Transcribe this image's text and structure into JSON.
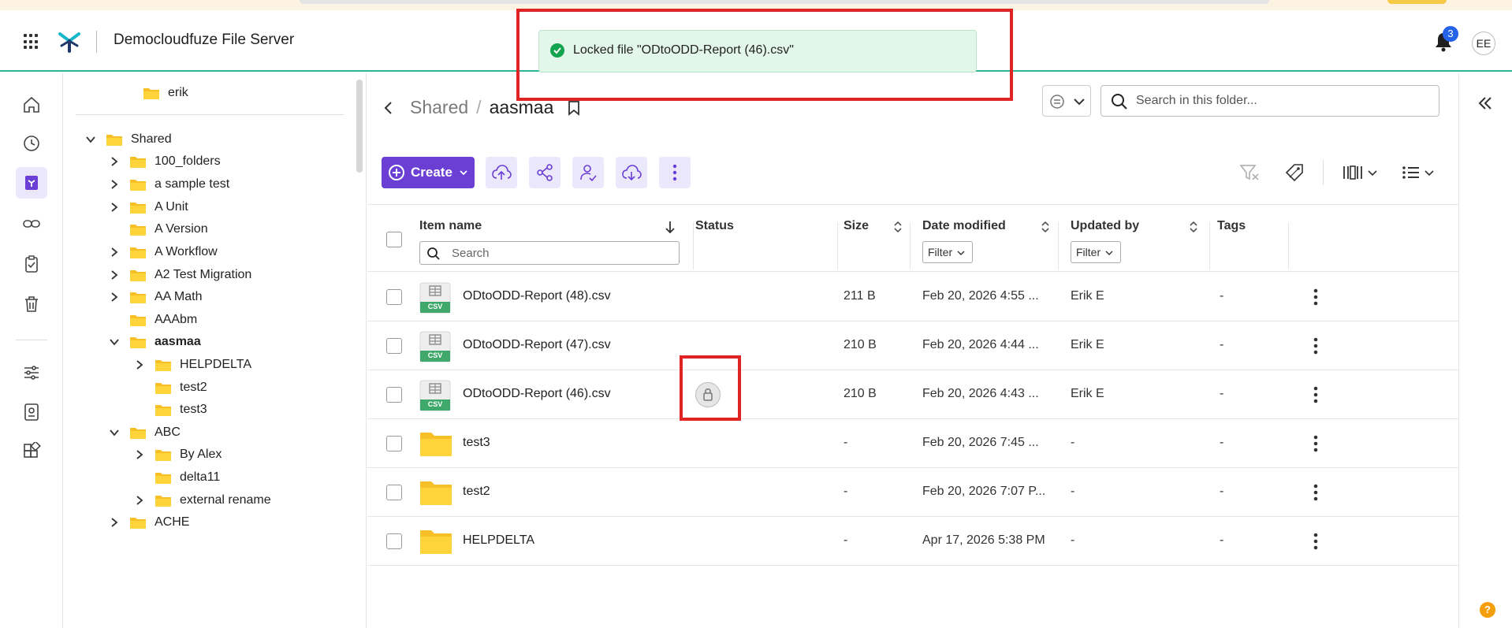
{
  "app": {
    "title": "Democloudfuze File Server",
    "notifications_count": "3",
    "user_initials": "EE",
    "accent_color": "#6b3fd4",
    "header_line_color": "#2fb39b"
  },
  "toast": {
    "message": "Locked file \"ODtoODD-Report (46).csv\"",
    "color": "#e3f6ea"
  },
  "rail": {
    "items": [
      "home-icon",
      "recent-clock-icon",
      "file-server-icon",
      "link-icon",
      "tasks-clipboard-icon",
      "trash-icon",
      "settings-sliders-icon",
      "report-icon",
      "apps-grid-icon"
    ]
  },
  "tree": {
    "items": [
      {
        "label": "erik",
        "chevron": "none",
        "bold": false
      },
      {
        "label": "Shared",
        "chevron": "down",
        "bold": false
      },
      {
        "label": "100_folders",
        "chevron": "right",
        "bold": false
      },
      {
        "label": "a sample test",
        "chevron": "right",
        "bold": false
      },
      {
        "label": "A Unit",
        "chevron": "right",
        "bold": false
      },
      {
        "label": "A Version",
        "chevron": "none",
        "bold": false
      },
      {
        "label": "A Workflow",
        "chevron": "right",
        "bold": false
      },
      {
        "label": "A2 Test Migration",
        "chevron": "right",
        "bold": false
      },
      {
        "label": "AA Math",
        "chevron": "right",
        "bold": false
      },
      {
        "label": "AAAbm",
        "chevron": "none",
        "bold": false
      },
      {
        "label": "aasmaa",
        "chevron": "down",
        "bold": true
      },
      {
        "label": "HELPDELTA",
        "chevron": "right",
        "bold": false
      },
      {
        "label": "test2",
        "chevron": "none",
        "bold": false
      },
      {
        "label": "test3",
        "chevron": "none",
        "bold": false
      },
      {
        "label": "ABC",
        "chevron": "down",
        "bold": false
      },
      {
        "label": "By Alex",
        "chevron": "right",
        "bold": false
      },
      {
        "label": "delta11",
        "chevron": "none",
        "bold": false
      },
      {
        "label": "external rename",
        "chevron": "right",
        "bold": false
      },
      {
        "label": "ACHE",
        "chevron": "right",
        "bold": false
      }
    ]
  },
  "breadcrumb": {
    "parent": "Shared",
    "separator": "/",
    "current": "aasmaa"
  },
  "search": {
    "placeholder": "Search in this folder..."
  },
  "toolbar": {
    "create_label": "Create"
  },
  "table": {
    "headers": {
      "name": "Item name",
      "status": "Status",
      "size": "Size",
      "date": "Date modified",
      "updated_by": "Updated by",
      "tags": "Tags"
    },
    "name_search_placeholder": "Search",
    "filter_label": "Filter",
    "rows": [
      {
        "type": "csv",
        "name": "ODtoODD-Report (48).csv",
        "size": "211 B",
        "date": "Feb 20, 2026 4:55 ...",
        "updated_by": "Erik E",
        "tags": "-",
        "locked": false
      },
      {
        "type": "csv",
        "name": "ODtoODD-Report (47).csv",
        "size": "210 B",
        "date": "Feb 20, 2026 4:44 ...",
        "updated_by": "Erik E",
        "tags": "-",
        "locked": false
      },
      {
        "type": "csv",
        "name": "ODtoODD-Report (46).csv",
        "size": "210 B",
        "date": "Feb 20, 2026 4:43 ...",
        "updated_by": "Erik E",
        "tags": "-",
        "locked": true
      },
      {
        "type": "folder",
        "name": "test3",
        "size": "-",
        "date": "Feb 20, 2026 7:45 ...",
        "updated_by": "-",
        "tags": "-",
        "locked": false
      },
      {
        "type": "folder",
        "name": "test2",
        "size": "-",
        "date": "Feb 20, 2026 7:07 P...",
        "updated_by": "-",
        "tags": "-",
        "locked": false
      },
      {
        "type": "folder",
        "name": "HELPDELTA",
        "size": "-",
        "date": "Apr 17, 2026 5:38 PM",
        "updated_by": "-",
        "tags": "-",
        "locked": false
      }
    ],
    "csv_badge": "CSV"
  },
  "help": {
    "label": "?"
  }
}
